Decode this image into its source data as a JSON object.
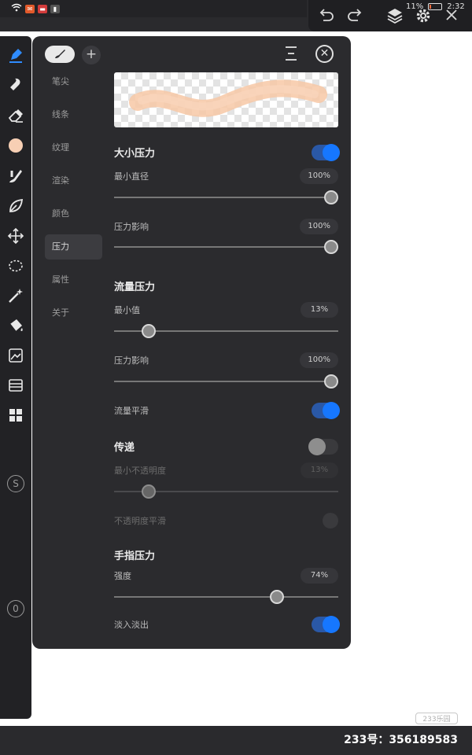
{
  "status_bar": {
    "battery": "11%",
    "time": "2:32"
  },
  "panel": {
    "nav": [
      {
        "label": "笔尖"
      },
      {
        "label": "线条"
      },
      {
        "label": "纹理"
      },
      {
        "label": "渲染"
      },
      {
        "label": "颜色"
      },
      {
        "label": "压力",
        "active": true
      },
      {
        "label": "属性"
      },
      {
        "label": "关于"
      }
    ],
    "size_pressure": {
      "title": "大小压力",
      "enabled": true,
      "min_diameter_label": "最小直径",
      "min_diameter_value": "100%",
      "min_diameter_fraction": 1.0,
      "pressure_effect_label": "压力影响",
      "pressure_effect_value": "100%",
      "pressure_effect_fraction": 1.0
    },
    "flow_pressure": {
      "title": "流量压力",
      "min_label": "最小值",
      "min_value": "13%",
      "min_fraction": 0.13,
      "pressure_effect_label": "压力影响",
      "pressure_effect_value": "100%",
      "pressure_effect_fraction": 1.0,
      "smoothing_label": "流量平滑",
      "smoothing_enabled": true
    },
    "transfer": {
      "title": "传递",
      "enabled": false,
      "min_opacity_label": "最小不透明度",
      "min_opacity_value": "13%",
      "min_opacity_fraction": 0.13,
      "opacity_smoothing_label": "不透明度平滑"
    },
    "finger_pressure": {
      "title": "手指压力",
      "strength_label": "强度",
      "strength_value": "74%",
      "strength_fraction": 0.74,
      "fade_label": "淡入淡出",
      "fade_enabled": true
    }
  },
  "sidebar": {
    "buttons": [
      {
        "icon": "pen-tool-icon",
        "active": true
      },
      {
        "icon": "smudge-icon"
      },
      {
        "icon": "eraser-icon"
      },
      {
        "icon": "color-swatch-icon",
        "color": "#f7cfb4"
      },
      {
        "icon": "brush-library-icon"
      },
      {
        "icon": "leaf-shape-icon"
      },
      {
        "icon": "transform-move-icon"
      },
      {
        "icon": "lasso-select-icon"
      },
      {
        "icon": "magic-wand-icon"
      },
      {
        "icon": "paint-bucket-icon"
      },
      {
        "icon": "image-adjust-icon"
      },
      {
        "icon": "reference-image-icon"
      },
      {
        "icon": "grid-layout-icon"
      }
    ],
    "s_badge": "S",
    "zero_badge": "0"
  },
  "watermark": "233乐园",
  "footer_id": "233号：356189583",
  "colors": {
    "accent": "#1677ff",
    "panel_bg": "#2b2b2e",
    "brush_stroke": "#f7c8a6"
  }
}
